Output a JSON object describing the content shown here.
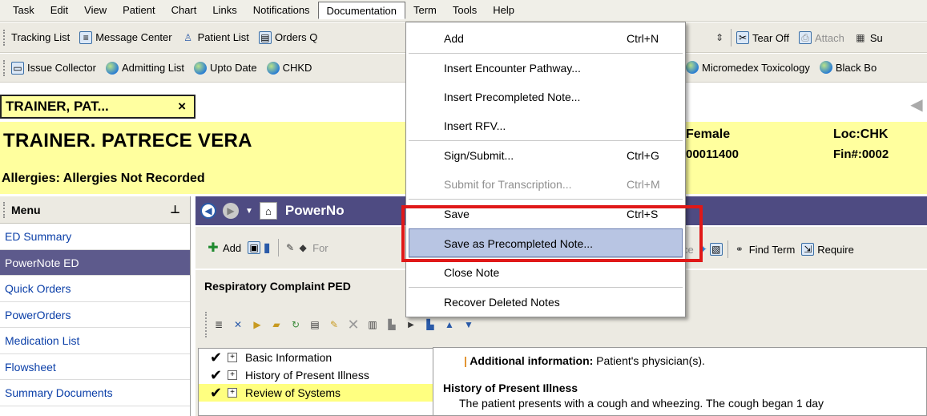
{
  "menubar": {
    "items": [
      "Task",
      "Edit",
      "View",
      "Patient",
      "Chart",
      "Links",
      "Notifications",
      "Documentation",
      "Term",
      "Tools",
      "Help"
    ],
    "active": "Documentation"
  },
  "toolbar1": {
    "items": [
      {
        "label": "Tracking List",
        "icon": "tracking-list-icon"
      },
      {
        "label": "Message Center",
        "icon": "message-center-icon"
      },
      {
        "label": "Patient List",
        "icon": "patient-list-icon"
      },
      {
        "label": "Orders Q",
        "icon": "orders-icon"
      }
    ],
    "right": [
      {
        "label": "Tear Off",
        "icon": "tear-off-icon"
      },
      {
        "label": "Attach",
        "icon": "attach-icon"
      },
      {
        "label": "Su",
        "icon": "suspend-icon"
      }
    ]
  },
  "toolbar2": {
    "items": [
      {
        "label": "Issue Collector",
        "icon": "issue-collector-icon"
      },
      {
        "label": "Admitting List",
        "icon": "globe-icon"
      },
      {
        "label": "Upto Date",
        "icon": "globe-icon"
      },
      {
        "label": "CHKD",
        "icon": "globe-icon"
      }
    ],
    "right": [
      {
        "label": "Micromedex Toxicology",
        "icon": "globe-icon"
      },
      {
        "label": "Black Bo",
        "icon": "globe-icon"
      }
    ]
  },
  "patient_tab": {
    "label": "TRAINER, PAT...",
    "close": "×"
  },
  "banner": {
    "name": "TRAINER. PATRECE VERA",
    "allergies": "Allergies: Allergies Not Recorded",
    "sex": "Female",
    "mrn": "00011400",
    "loc": "Loc:CHK",
    "fin": "Fin#:0002"
  },
  "sidemenu": {
    "title": "Menu",
    "items": [
      "ED Summary",
      "PowerNote ED",
      "Quick Orders",
      "PowerOrders",
      "Medication List",
      "Flowsheet",
      "Summary Documents"
    ],
    "selected": "PowerNote ED"
  },
  "navbar": {
    "title": "PowerNo"
  },
  "pntoolbar": {
    "add": "Add",
    "for": "For",
    "ce": "ce",
    "find_term": "Find Term",
    "require": "Require"
  },
  "note": {
    "header": "Respiratory Complaint PED",
    "tree": [
      {
        "label": "Basic Information",
        "checked": true,
        "highlight": false
      },
      {
        "label": "History of Present Illness",
        "checked": true,
        "highlight": false
      },
      {
        "label": "Review of Systems",
        "checked": true,
        "highlight": true
      }
    ],
    "additional_label": "Additional information:",
    "additional_text": " Patient's physician(s).",
    "hpi_title": "History of Present Illness",
    "hpi_text": "The patient presents with a cough and wheezing.  The cough began 1  day"
  },
  "dropdown": {
    "items": [
      {
        "label": "Add",
        "shortcut": "Ctrl+N",
        "disabled": false
      },
      {
        "sep": true
      },
      {
        "label": "Insert Encounter Pathway...",
        "shortcut": "",
        "disabled": false
      },
      {
        "label": "Insert Precompleted Note...",
        "shortcut": "",
        "disabled": false
      },
      {
        "label": "Insert RFV...",
        "shortcut": "",
        "disabled": false
      },
      {
        "sep": true
      },
      {
        "label": "Sign/Submit...",
        "shortcut": "Ctrl+G",
        "disabled": false
      },
      {
        "label": "Submit for Transcription...",
        "shortcut": "Ctrl+M",
        "disabled": true
      },
      {
        "sep": true
      },
      {
        "label": "Save",
        "shortcut": "Ctrl+S",
        "disabled": false
      },
      {
        "label": "Save as Precompleted Note...",
        "shortcut": "",
        "disabled": false,
        "hover": true
      },
      {
        "sep": true
      },
      {
        "label": "Close Note",
        "shortcut": "",
        "disabled": false
      },
      {
        "sep": true
      },
      {
        "label": "Recover Deleted Notes",
        "shortcut": "",
        "disabled": false
      }
    ]
  },
  "colors": {
    "banner": "#ffff9e",
    "navbar": "#4e4b82",
    "selected": "#5d5a8c",
    "highlight_box": "#e01818",
    "menu_hover": "#b8c5e3"
  }
}
